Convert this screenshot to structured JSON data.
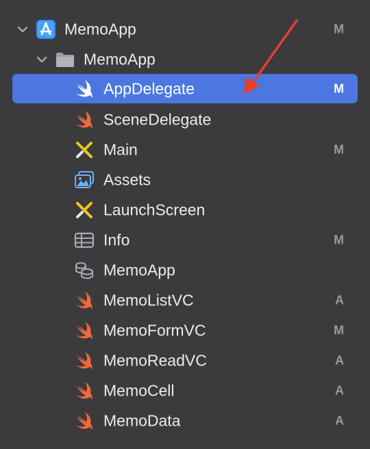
{
  "project": {
    "label": "MemoApp",
    "status": "M",
    "icon": "xcode-project-icon"
  },
  "group": {
    "label": "MemoApp",
    "icon": "folder-icon"
  },
  "files": [
    {
      "label": "AppDelegate",
      "status": "M",
      "icon": "swift-icon",
      "selected": true
    },
    {
      "label": "SceneDelegate",
      "status": "",
      "icon": "swift-icon"
    },
    {
      "label": "Main",
      "status": "M",
      "icon": "storyboard-icon"
    },
    {
      "label": "Assets",
      "status": "",
      "icon": "asset-catalog-icon"
    },
    {
      "label": "LaunchScreen",
      "status": "",
      "icon": "storyboard-icon"
    },
    {
      "label": "Info",
      "status": "M",
      "icon": "plist-icon"
    },
    {
      "label": "MemoApp",
      "status": "",
      "icon": "core-data-model-icon"
    },
    {
      "label": "MemoListVC",
      "status": "A",
      "icon": "swift-icon"
    },
    {
      "label": "MemoFormVC",
      "status": "M",
      "icon": "swift-icon"
    },
    {
      "label": "MemoReadVC",
      "status": "A",
      "icon": "swift-icon"
    },
    {
      "label": "MemoCell",
      "status": "A",
      "icon": "swift-icon"
    },
    {
      "label": "MemoData",
      "status": "A",
      "icon": "swift-icon"
    }
  ],
  "colors": {
    "background": "#3b3b3d",
    "selection": "#4c77e0",
    "swift_orange": "#f26a3a",
    "annotation_arrow": "#e5402f"
  }
}
